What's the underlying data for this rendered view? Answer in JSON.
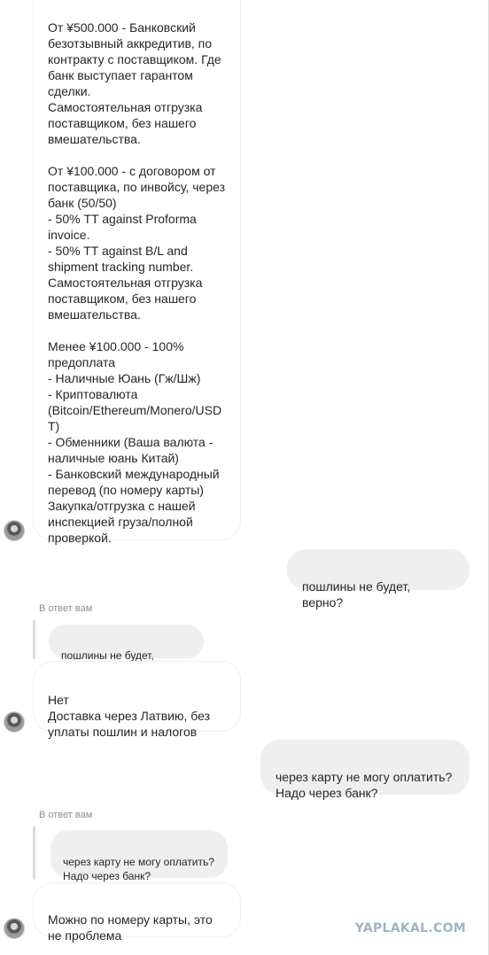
{
  "messages": {
    "payment_terms": "От ¥500.000 - Банковский\nбезотзывный аккредитив, по\nконтракту с поставщиком. Где\nбанк выступает гарантом\nсделки.\nСамостоятельная отгрузка\nпоставщиком, без нашего\nвмешательства.\n\nОт ¥100.000 - с договором от\nпоставщика, по инвойсу, через\nбанк (50/50)\n- 50% TT against Proforma\ninvoice.\n- 50% TT against B/L and\nshipment tracking number.\nСамостоятельная отгрузка\nпоставщиком, без нашего\nвмешательства.\n\nМенее ¥100.000 - 100%\nпредоплата\n- Наличные Юань (Гж/Шж)\n- Криптовалюта\n(Bitcoin/Ethereum/Monero/USD\nT)\n- Обменники (Ваша валюта -\nналичные юань Китай)\n- Банковский международный\nперевод (по номеру карты)\nЗакупка/отгрузка с нашей\nинспекцией груза/полной\nпроверкой.",
    "me_question_1": "пошлины не будет, верно?",
    "reply_label_1": "В ответ вам",
    "quote_1": "пошлины не будет, верно?",
    "answer_1": "Нет\nДоставка через Латвию, без\nуплаты пошлин и налогов",
    "me_question_2": "через карту не могу оплатить?\nНадо через банк?",
    "reply_label_2": "В ответ вам",
    "quote_2": "через карту не могу оплатить?\nНадо через банк?",
    "answer_2": "Можно по номеру карты, это\nне проблема"
  },
  "watermark": "YAPLAKAL.COM",
  "colors": {
    "my_bubble": "#efefef",
    "their_bubble_border": "#efefef",
    "muted_text": "#8e8e8e",
    "watermark": "#9fb3c7"
  }
}
